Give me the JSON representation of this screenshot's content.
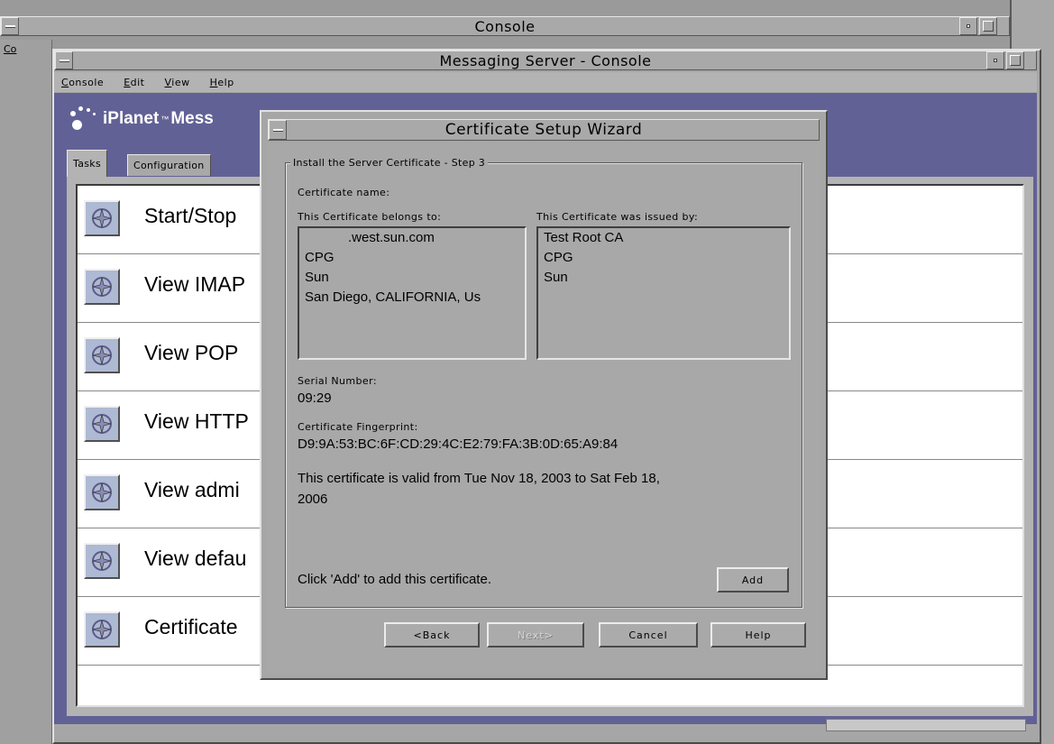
{
  "outer_window": {
    "title": "Console",
    "menu_fragment": "Co"
  },
  "inner_window": {
    "title": "Messaging Server - Console",
    "menu": [
      "Console",
      "Edit",
      "View",
      "Help"
    ],
    "brand_text": "iPlanet",
    "brand_tm": "™",
    "brand_suffix": "Mess",
    "tabs": [
      "Tasks",
      "Configuration"
    ],
    "tasks": [
      {
        "label": "Start/Stop"
      },
      {
        "label": "View IMAP"
      },
      {
        "label": "View POP"
      },
      {
        "label": "View HTTP"
      },
      {
        "label": "View admi"
      },
      {
        "label": "View defau"
      },
      {
        "label": "Certificate"
      }
    ]
  },
  "wizard": {
    "title": "Certificate Setup Wizard",
    "group_title": "Install the Server Certificate - Step 3",
    "certificate_name_label": "Certificate name:",
    "belongs_to_label": "This Certificate belongs to:",
    "issued_by_label": "This Certificate was issued by:",
    "belongs_to": [
      ".west.sun.com",
      "CPG",
      "Sun",
      "San Diego, CALIFORNIA, Us"
    ],
    "issued_by": [
      "Test Root CA",
      "CPG",
      "Sun"
    ],
    "serial_label": "Serial Number:",
    "serial_value": "09:29",
    "fingerprint_label": "Certificate Fingerprint:",
    "fingerprint_value": "D9:9A:53:BC:6F:CD:29:4C:E2:79:FA:3B:0D:65:A9:84",
    "validity_line1": "This certificate is valid from Tue Nov 18, 2003 to Sat Feb 18,",
    "validity_line2": "2006",
    "add_prompt": "Click 'Add' to add this certificate.",
    "add_button": "Add",
    "buttons": {
      "back": "<Back",
      "next": "Next>",
      "cancel": "Cancel",
      "help": "Help"
    }
  }
}
